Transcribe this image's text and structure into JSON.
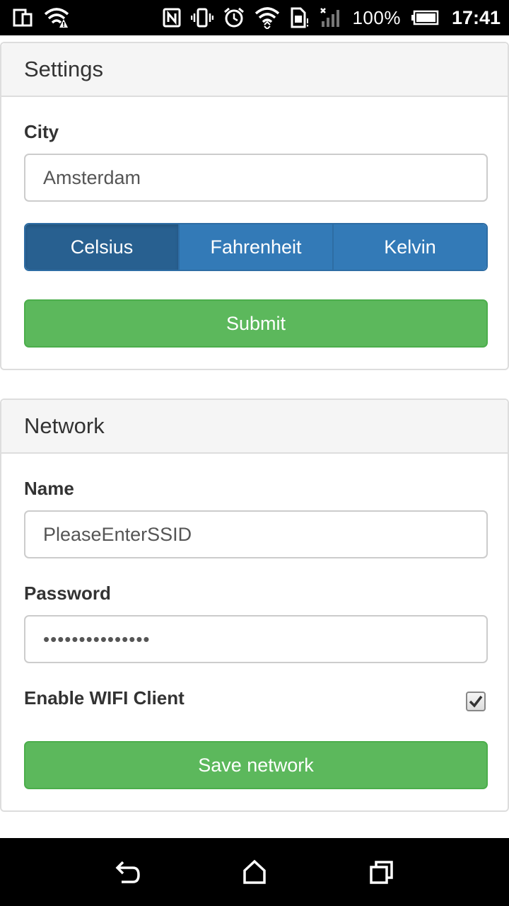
{
  "status_bar": {
    "battery_percent": "100%",
    "time": "17:41",
    "icons": [
      "screen-mirror-icon",
      "wifi-alert-icon",
      "nfc-icon",
      "vibrate-icon",
      "alarm-icon",
      "wifi-icon",
      "sim-icon",
      "signal-icon",
      "battery-icon"
    ]
  },
  "settings_panel": {
    "title": "Settings",
    "city_label": "City",
    "city_value": "Amsterdam",
    "units": [
      {
        "label": "Celsius",
        "active": true
      },
      {
        "label": "Fahrenheit",
        "active": false
      },
      {
        "label": "Kelvin",
        "active": false
      }
    ],
    "submit_label": "Submit"
  },
  "network_panel": {
    "title": "Network",
    "name_label": "Name",
    "name_value": "PleaseEnterSSID",
    "password_label": "Password",
    "password_value": "•••••••••••••••",
    "wifi_client_label": "Enable WIFI Client",
    "wifi_client_checked": true,
    "save_label": "Save network"
  },
  "nav_bar": {
    "icons": [
      "back-icon",
      "home-icon",
      "recents-icon"
    ]
  },
  "colors": {
    "primary": "#337ab7",
    "primary_active": "#286090",
    "success": "#5cb85c"
  }
}
